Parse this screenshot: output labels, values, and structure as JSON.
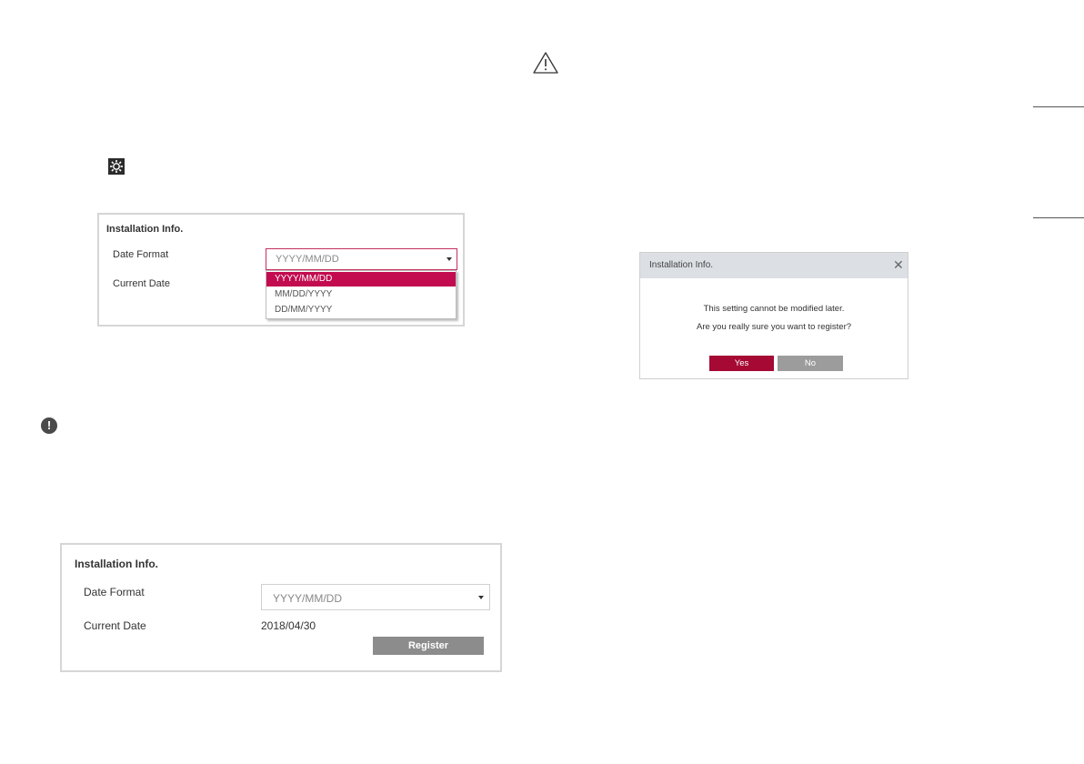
{
  "panel1": {
    "title": "Installation Info.",
    "date_format_label": "Date Format",
    "current_date_label": "Current Date",
    "select_value": "YYYY/MM/DD",
    "options": [
      "YYYY/MM/DD",
      "MM/DD/YYYY",
      "DD/MM/YYYY"
    ],
    "selected_option": "YYYY/MM/DD"
  },
  "panel2": {
    "title": "Installation Info.",
    "date_format_label": "Date Format",
    "current_date_label": "Current Date",
    "select_value": "YYYY/MM/DD",
    "current_date_value": "2018/04/30",
    "register_label": "Register"
  },
  "dialog": {
    "title": "Installation Info.",
    "close_glyph": "✕",
    "message_line1": "This setting cannot be modified later.",
    "message_line2": "Are you really sure you want to register?",
    "yes_label": "Yes",
    "no_label": "No"
  },
  "icons": {
    "settings": "gear-icon",
    "note": "exclamation-icon",
    "warning": "warning-triangle-icon"
  },
  "colors": {
    "accent": "#c20c4f",
    "yes_button": "#a50934",
    "register_button": "#8c8c8c"
  }
}
